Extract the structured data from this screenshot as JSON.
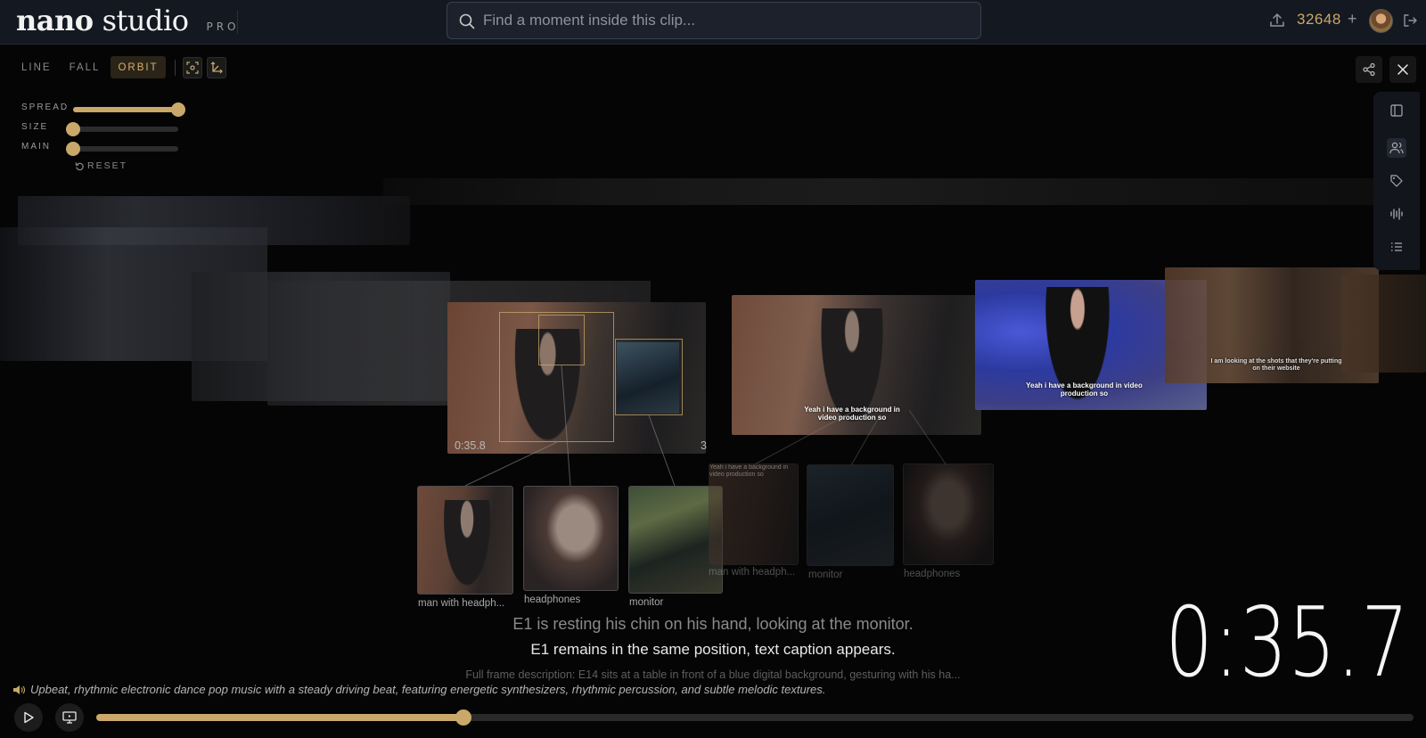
{
  "app": {
    "name_bold": "nano",
    "name_light": "studio",
    "tier": "PRO"
  },
  "search": {
    "placeholder": "Find a moment inside this clip..."
  },
  "account": {
    "credits": "32648",
    "add_label": "+"
  },
  "modes": [
    "LINE",
    "FALL",
    "ORBIT"
  ],
  "active_mode": "ORBIT",
  "controls": {
    "sliders": [
      {
        "label": "SPREAD",
        "value": 1.0
      },
      {
        "label": "SIZE",
        "value": 0.0
      },
      {
        "label": "MAIN",
        "value": 0.0
      }
    ],
    "reset_label": "RESET"
  },
  "scene": {
    "main_frame": {
      "timestamp": "0:35.8",
      "object_count": "3"
    },
    "frame_captions": {
      "second": "Yeah i have a background in video production so",
      "third": "Yeah i have a background in video production so",
      "fourth": "I am looking at the shots that they're putting on their website"
    },
    "objects": [
      {
        "label": "man with headph..."
      },
      {
        "label": "headphones"
      },
      {
        "label": "monitor"
      }
    ],
    "ghost_objects": [
      {
        "label": "man with headph...",
        "caption": "Yeah i have a background in video production so"
      },
      {
        "label": "monitor"
      },
      {
        "label": "headphones"
      }
    ]
  },
  "description": {
    "previous": "E1 is resting his chin on his hand, looking at the monitor.",
    "current": "E1 remains in the same position, text caption appears.",
    "full_frame": "Full frame description: E14 sits at a table in front of a blue digital background, gesturing with his ha..."
  },
  "timecode": "0:35.7",
  "music": "Upbeat, rhythmic electronic dance pop music with a steady driving beat, featuring energetic synthesizers, rhythmic percussion, and subtle melodic textures.",
  "player": {
    "progress": 0.279
  },
  "colors": {
    "accent": "#c9a86a",
    "background": "#050505",
    "topbar": "#141820"
  }
}
